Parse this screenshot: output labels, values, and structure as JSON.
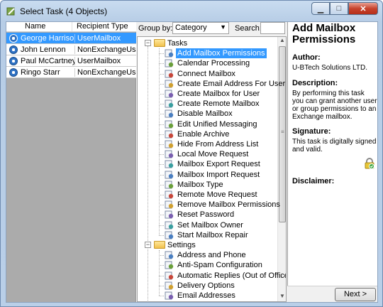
{
  "window": {
    "title": "Select Task (4 Objects)"
  },
  "objects": {
    "columns": [
      "Name",
      "Recipient Type"
    ],
    "rows": [
      {
        "name": "George Harrison",
        "type": "UserMailbox",
        "selected": true
      },
      {
        "name": "John Lennon",
        "type": "NonExchangeUser",
        "selected": false
      },
      {
        "name": "Paul McCartney",
        "type": "UserMailbox",
        "selected": false
      },
      {
        "name": "Ringo Starr",
        "type": "NonExchangeUser",
        "selected": false
      }
    ]
  },
  "toolbar": {
    "groupby_label": "Group by:",
    "groupby_value": "Category",
    "search_label": "Search:",
    "search_value": ""
  },
  "tree": {
    "groups": [
      {
        "label": "Tasks",
        "items": [
          "Add Mailbox Permissions",
          "Calendar Processing",
          "Connect Mailbox",
          "Create Email Address For User",
          "Create Mailbox for User",
          "Create Remote Mailbox",
          "Disable Mailbox",
          "Edit Unified Messaging",
          "Enable Archive",
          "Hide From Address List",
          "Local Move Request",
          "Mailbox Export Request",
          "Mailbox Import Request",
          "Mailbox Type",
          "Remote Move Request",
          "Remove Mailbox Permissions",
          "Reset Password",
          "Set Mailbox Owner",
          "Start Mailbox Repair"
        ]
      },
      {
        "label": "Settings",
        "items": [
          "Address and Phone",
          "Anti-Spam Configuration",
          "Automatic Replies (Out of Office)",
          "Delivery Options",
          "Email Addresses"
        ]
      }
    ],
    "selected": "Add Mailbox Permissions"
  },
  "info": {
    "title": "Add Mailbox Permissions",
    "author_label": "Author:",
    "author": "U-BTech Solutions LTD.",
    "description_label": "Description:",
    "description": "By performing this task you can grant another user or group permissions to an Exchange mailbox.",
    "signature_label": "Signature:",
    "signature": "This task is digitally signed and valid.",
    "disclaimer_label": "Disclaimer:"
  },
  "buttons": {
    "next": "Next >"
  },
  "colors": {
    "selection": "#3399ff",
    "objlist_bg": "#ababab"
  }
}
